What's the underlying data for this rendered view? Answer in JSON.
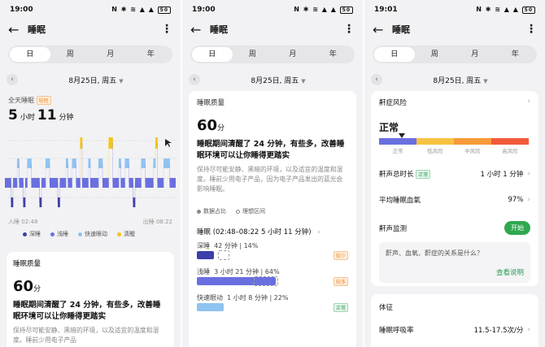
{
  "status": {
    "time_1": "19:00",
    "time_2": "19:00",
    "time_3": "19:01",
    "battery": "50"
  },
  "appbar": {
    "title": "睡眠"
  },
  "tabs": [
    "日",
    "周",
    "月",
    "年"
  ],
  "date": "8月25日, 周五",
  "summary": {
    "label": "全天睡眠",
    "badge": "较短",
    "hours": "5",
    "hours_unit": "小时",
    "minutes": "11",
    "minutes_unit": "分钟",
    "sleep_in": "入睡 02:48",
    "wake_up": "出睡 08:22",
    "legend": [
      "深睡",
      "浅睡",
      "快速眼动",
      "清醒"
    ]
  },
  "colors": {
    "deep": "#3b3fa8",
    "light": "#6a6fe0",
    "rem": "#8fc3f0",
    "awake": "#f5c518",
    "accent_green": "#2fa84f",
    "tag_orange": "#f08a24"
  },
  "quality": {
    "title": "睡眠质量",
    "score": "60",
    "score_unit": "分",
    "headline": "睡眠期间清醒了 24 分钟，有些多，改善睡眠环境可以让你睡得更踏实",
    "desc_p1": "保持尽可能安静、黑暗的环境，以及适宜的温度和湿度。睡前少用电子产品",
    "desc_p2": "保持尽可能安静、黑暗的环境，以及适宜的温度和湿度。睡前少用电子产品，因为电子产品发出的蓝光会影响睡眠。",
    "legend_data": "数据占比",
    "legend_ideal": "理想区间",
    "period": "睡眠 (02:48–08:22  5 小时 11 分钟)",
    "stages": [
      {
        "name": "深睡",
        "detail": "42 分钟 | 14%",
        "tag": "较少",
        "fill": 0.14
      },
      {
        "name": "浅睡",
        "detail": "3 小时 21 分钟 | 64%",
        "tag": "较多",
        "fill": 0.64
      },
      {
        "name": "快速眼动",
        "detail": "1 小时 8 分钟 | 22%",
        "tag": "正常",
        "fill": 0.22
      }
    ]
  },
  "risk": {
    "title": "鼾症风险",
    "status": "正常",
    "levels": [
      "正常",
      "低风险",
      "中风险",
      "高风险"
    ],
    "level_colors": [
      "#6a6fe0",
      "#f6c342",
      "#f79a3a",
      "#f15a3a"
    ],
    "rows": [
      {
        "label": "鼾声总时长",
        "tag": "正常",
        "value": "1 小时 1 分钟"
      },
      {
        "label": "平均睡眠血氧",
        "value": "97%"
      },
      {
        "label": "鼾声监测",
        "button": "开始"
      }
    ],
    "question": "鼾声、血氧、鼾症的关系是什么？",
    "link": "查看说明"
  },
  "signs": {
    "title": "体征",
    "rows": [
      {
        "label": "睡眠呼吸率",
        "value": "11.5-17.5次/分"
      }
    ]
  }
}
